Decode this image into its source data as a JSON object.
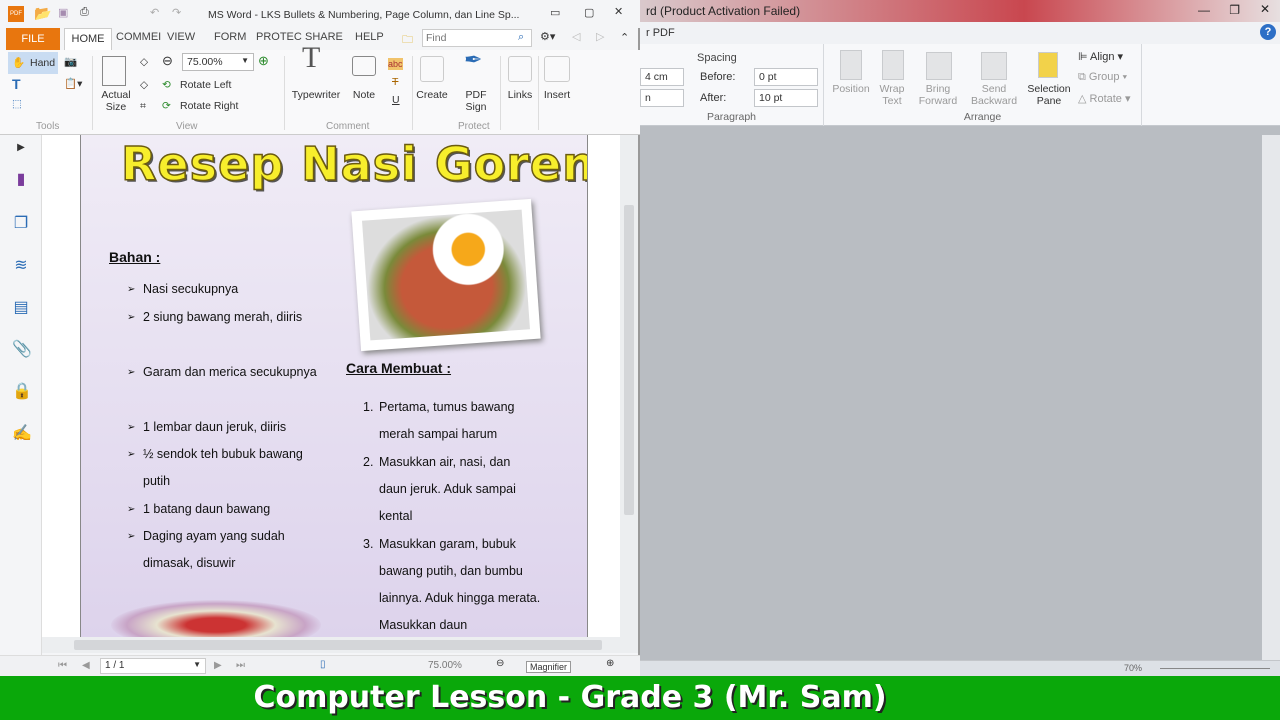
{
  "word": {
    "title": "rd (Product Activation Failed)",
    "menu_fragment": "r PDF",
    "spacing_label": "Spacing",
    "indent_value1": "4 cm",
    "indent_value2": "n",
    "before_label": "Before:",
    "before_value": "0 pt",
    "after_label": "After:",
    "after_value": "10 pt",
    "paragraph_label": "Paragraph",
    "arrange": {
      "position": "Position",
      "wrap_text": "Wrap Text",
      "bring_forward": "Bring Forward",
      "send_backward": "Send Backward",
      "selection_pane": "Selection Pane",
      "align": "Align",
      "group": "Group",
      "rotate": "Rotate",
      "label": "Arrange"
    },
    "zoom": "70%"
  },
  "foxit": {
    "title": "MS Word - LKS Bullets & Numbering, Page Column, dan Line Sp...",
    "tabs": [
      "FILE",
      "HOME",
      "COMMEI",
      "VIEW",
      "FORM",
      "PROTEC",
      "SHARE",
      "HELP"
    ],
    "find_placeholder": "Find",
    "tools": {
      "hand": "Hand",
      "label": "Tools"
    },
    "view": {
      "actual_size": "Actual Size",
      "zoom": "75.00%",
      "rotate_left": "Rotate Left",
      "rotate_right": "Rotate Right",
      "label": "View"
    },
    "comment": {
      "typewriter": "Typewriter",
      "note": "Note",
      "label": "Comment"
    },
    "protect": {
      "create": "Create",
      "pdf_sign": "PDF Sign",
      "label": "Protect"
    },
    "links": "Links",
    "insert": "Insert",
    "status": {
      "page": "1 / 1",
      "zoom": "75.00%",
      "magnifier": "Magnifier"
    }
  },
  "document": {
    "title": "Resep Nasi Goreng",
    "bahan_heading": "Bahan :",
    "bahan": [
      "Nasi secukupnya",
      "2 siung bawang merah, diiris",
      "Garam dan merica secukupnya",
      "1 lembar daun jeruk, diiris",
      "½ sendok teh bubuk bawang putih",
      "1 batang daun bawang",
      "Daging ayam yang sudah dimasak, disuwir"
    ],
    "cara_heading": "Cara Membuat :",
    "cara": [
      "Pertama, tumus bawang merah sampai harum",
      "Masukkan air, nasi, dan daun jeruk. Aduk sampai kental",
      "Masukkan garam, bubuk bawang putih, dan bumbu lainnya. Aduk hingga merata. Masukkan daun"
    ]
  },
  "banner": "Computer Lesson - Grade 3  (Mr. Sam)",
  "colors": {
    "file_tab": "#e8760e",
    "banner": "#0aa80a",
    "page": "#e3daf0",
    "title_text": "#f7ee2c"
  }
}
